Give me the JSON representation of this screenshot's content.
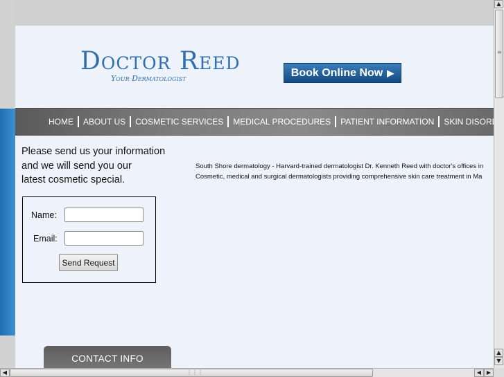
{
  "logo": {
    "title": "Doctor Reed",
    "subtitle": "Your Dermatologist"
  },
  "book_button": {
    "label": "Book Online Now",
    "arrow": "▶"
  },
  "nav": {
    "items": [
      {
        "label": "HOME"
      },
      {
        "label": "ABOUT US"
      },
      {
        "label": "COSMETIC SERVICES"
      },
      {
        "label": "MEDICAL PROCEDURES"
      },
      {
        "label": "PATIENT INFORMATION"
      },
      {
        "label": "SKIN DISORDER INFO"
      }
    ]
  },
  "form": {
    "intro_lines": [
      "Please send us your information",
      "and we will send you our",
      "latest cosmetic special."
    ],
    "name_label": "Name:",
    "name_value": "",
    "email_label": "Email:",
    "email_value": "",
    "submit_label": "Send Request"
  },
  "description": {
    "line1": "South Shore dermatology - Harvard-trained dermatologist Dr. Kenneth Reed with doctor's offices in",
    "line2": "Cosmetic, medical and surgical dermatologists providing comprehensive skin care treatment in Ma"
  },
  "contact_tab": {
    "label": "CONTACT INFO"
  },
  "colors": {
    "brand_blue": "#2f6fb0",
    "nav_gray": "#7a7a7a",
    "page_bg": "#eef2fa"
  }
}
